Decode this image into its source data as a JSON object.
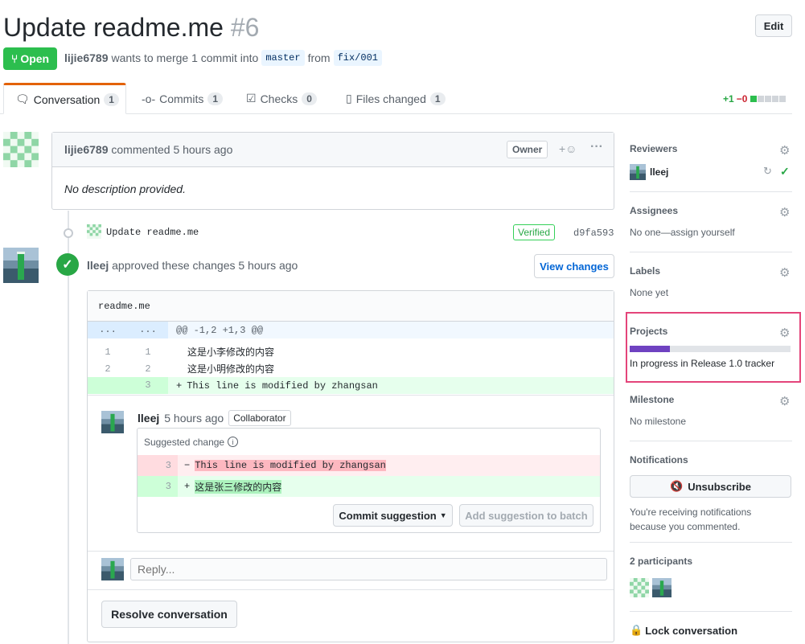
{
  "header": {
    "title": "Update readme.me",
    "number": "#6",
    "edit_label": "Edit",
    "status": "Open",
    "author": "lijie6789",
    "merge_text": "wants to merge 1 commit into",
    "base_branch": "master",
    "from_text": "from",
    "head_branch": "fix/001"
  },
  "tabs": [
    {
      "label": "Conversation",
      "count": "1"
    },
    {
      "label": "Commits",
      "count": "1"
    },
    {
      "label": "Checks",
      "count": "0"
    },
    {
      "label": "Files changed",
      "count": "1"
    }
  ],
  "diffstat": {
    "added": "+1",
    "removed": "−0"
  },
  "first_comment": {
    "author": "lijie6789",
    "action": "commented",
    "time": "5 hours ago",
    "role": "Owner",
    "body": "No description provided."
  },
  "commit": {
    "message": "Update readme.me",
    "verified": "Verified",
    "sha": "d9fa593"
  },
  "review": {
    "author": "lleej",
    "action": "approved these changes",
    "time": "5 hours ago",
    "view_changes": "View changes",
    "file": "readme.me",
    "hunk_old": "...",
    "hunk_new": "...",
    "hunk_header": "@@ -1,2 +1,3 @@",
    "lines": [
      {
        "old": "1",
        "new": "1",
        "sign": "",
        "text": "这是小李修改的内容"
      },
      {
        "old": "2",
        "new": "2",
        "sign": "",
        "text": "这是小明修改的内容"
      },
      {
        "old": "",
        "new": "3",
        "sign": "+",
        "text": "This line is modified by zhangsan"
      }
    ]
  },
  "review_comment": {
    "author": "lleej",
    "time": "5 hours ago",
    "role": "Collaborator",
    "suggestion_title": "Suggested change",
    "removed": {
      "line": "3",
      "sign": "−",
      "text": "This line is modified by zhangsan"
    },
    "added": {
      "line": "3",
      "sign": "+",
      "text": "这是张三修改的内容"
    },
    "commit_btn": "Commit suggestion",
    "batch_btn": "Add suggestion to batch",
    "reply_placeholder": "Reply...",
    "resolve_btn": "Resolve conversation"
  },
  "sidebar": {
    "reviewers_title": "Reviewers",
    "reviewer": "lleej",
    "assignees_title": "Assignees",
    "assignees_text": "No one—assign yourself",
    "labels_title": "Labels",
    "labels_text": "None yet",
    "projects_title": "Projects",
    "projects_progress": 0.25,
    "projects_text": "In progress in Release 1.0 tracker",
    "milestone_title": "Milestone",
    "milestone_text": "No milestone",
    "notifications_title": "Notifications",
    "unsubscribe_label": "Unsubscribe",
    "notifications_text_1": "You're receiving notifications",
    "notifications_text_2": "because you commented.",
    "participants_title": "2 participants",
    "lock_label": "Lock conversation"
  },
  "colors": {
    "green": "#2cbe4e",
    "highlight": "#e4447a",
    "progress": "#6f42c1",
    "link": "#0366d6"
  }
}
